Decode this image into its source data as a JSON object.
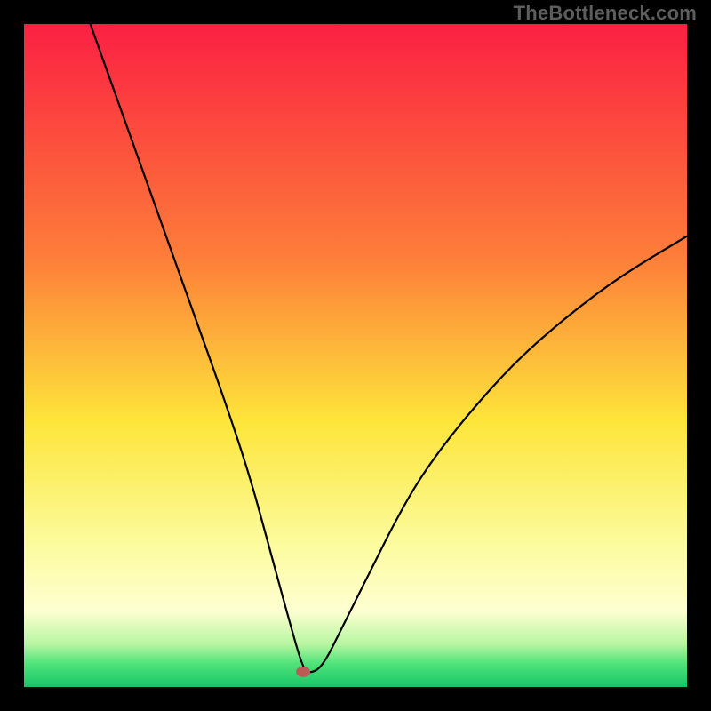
{
  "watermark": "TheBottleneck.com",
  "plot": {
    "inner_left": 27,
    "inner_top": 27,
    "inner_w": 746,
    "inner_h": 746,
    "xlim": [
      0,
      100
    ],
    "ylim": [
      0,
      100
    ],
    "gradient_stops": [
      {
        "offset": 0,
        "color": "#fb2042"
      },
      {
        "offset": 0.35,
        "color": "#fd7d39"
      },
      {
        "offset": 0.6,
        "color": "#fde53a"
      },
      {
        "offset": 0.78,
        "color": "#fcfb9b"
      },
      {
        "offset": 0.885,
        "color": "#feffd1"
      },
      {
        "offset": 0.935,
        "color": "#b8f6a1"
      },
      {
        "offset": 0.965,
        "color": "#4fe37a"
      },
      {
        "offset": 1.0,
        "color": "#18c667"
      }
    ],
    "curve": {
      "stroke": "#000000",
      "thickness": 2.2
    },
    "marker": {
      "x_frac": 0.421,
      "y_frac": 0.977,
      "rx": 8,
      "ry": 6,
      "fill": "#bc5b55"
    }
  },
  "chart_data": {
    "type": "line",
    "title": "",
    "xlabel": "",
    "ylabel": "",
    "note": "V-shaped bottleneck curve with heat-map background (red=high bottleneck, green=balanced). Minimum at x≈42.",
    "xlim": [
      0,
      100
    ],
    "ylim": [
      0,
      100
    ],
    "legend": false,
    "grid": false,
    "series": [
      {
        "name": "bottleneck-curve",
        "x": [
          10,
          15,
          20,
          25,
          30,
          34,
          37,
          40,
          42,
          43,
          45,
          48,
          52,
          56,
          60,
          66,
          74,
          82,
          90,
          100
        ],
        "values": [
          100,
          86,
          72,
          58,
          44,
          32,
          21,
          10,
          3,
          2,
          3,
          9,
          17,
          25,
          32,
          40,
          49,
          56,
          62,
          68
        ]
      }
    ],
    "marker": {
      "name": "selected-point",
      "x": 42,
      "y": 2
    }
  }
}
